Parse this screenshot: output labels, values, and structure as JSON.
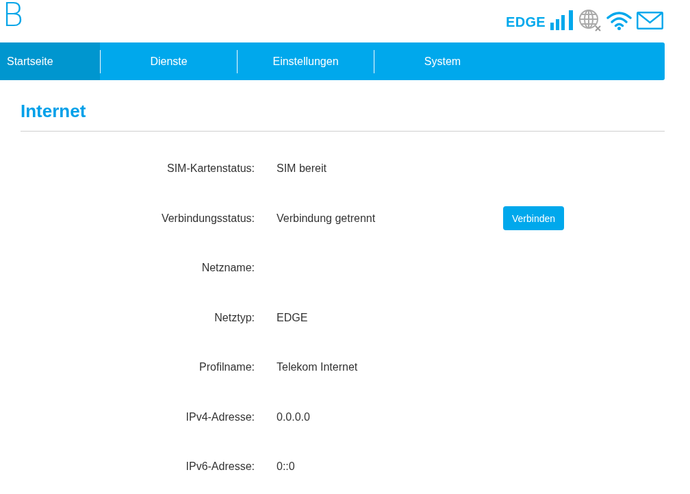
{
  "header": {
    "logo": "B",
    "network_type": "EDGE",
    "internet_connected": false
  },
  "nav": {
    "tabs": [
      {
        "label": "Startseite",
        "selected": true
      },
      {
        "label": "Dienste",
        "selected": false
      },
      {
        "label": "Einstellungen",
        "selected": false
      },
      {
        "label": "System",
        "selected": false
      }
    ]
  },
  "section": {
    "title": "Internet",
    "rows": [
      {
        "label": "SIM-Kartenstatus:",
        "value": "SIM bereit"
      },
      {
        "label": "Verbindungsstatus:",
        "value": "Verbindung getrennt",
        "action": "Verbinden"
      },
      {
        "label": "Netzname:"
      },
      {
        "label": "Netztyp:",
        "value": "EDGE"
      },
      {
        "label": "Profilname:",
        "value": "Telekom Internet"
      },
      {
        "label": "IPv4-Adresse:",
        "value": "0.0.0.0"
      },
      {
        "label": "IPv6-Adresse:",
        "value": "0::0"
      }
    ]
  }
}
